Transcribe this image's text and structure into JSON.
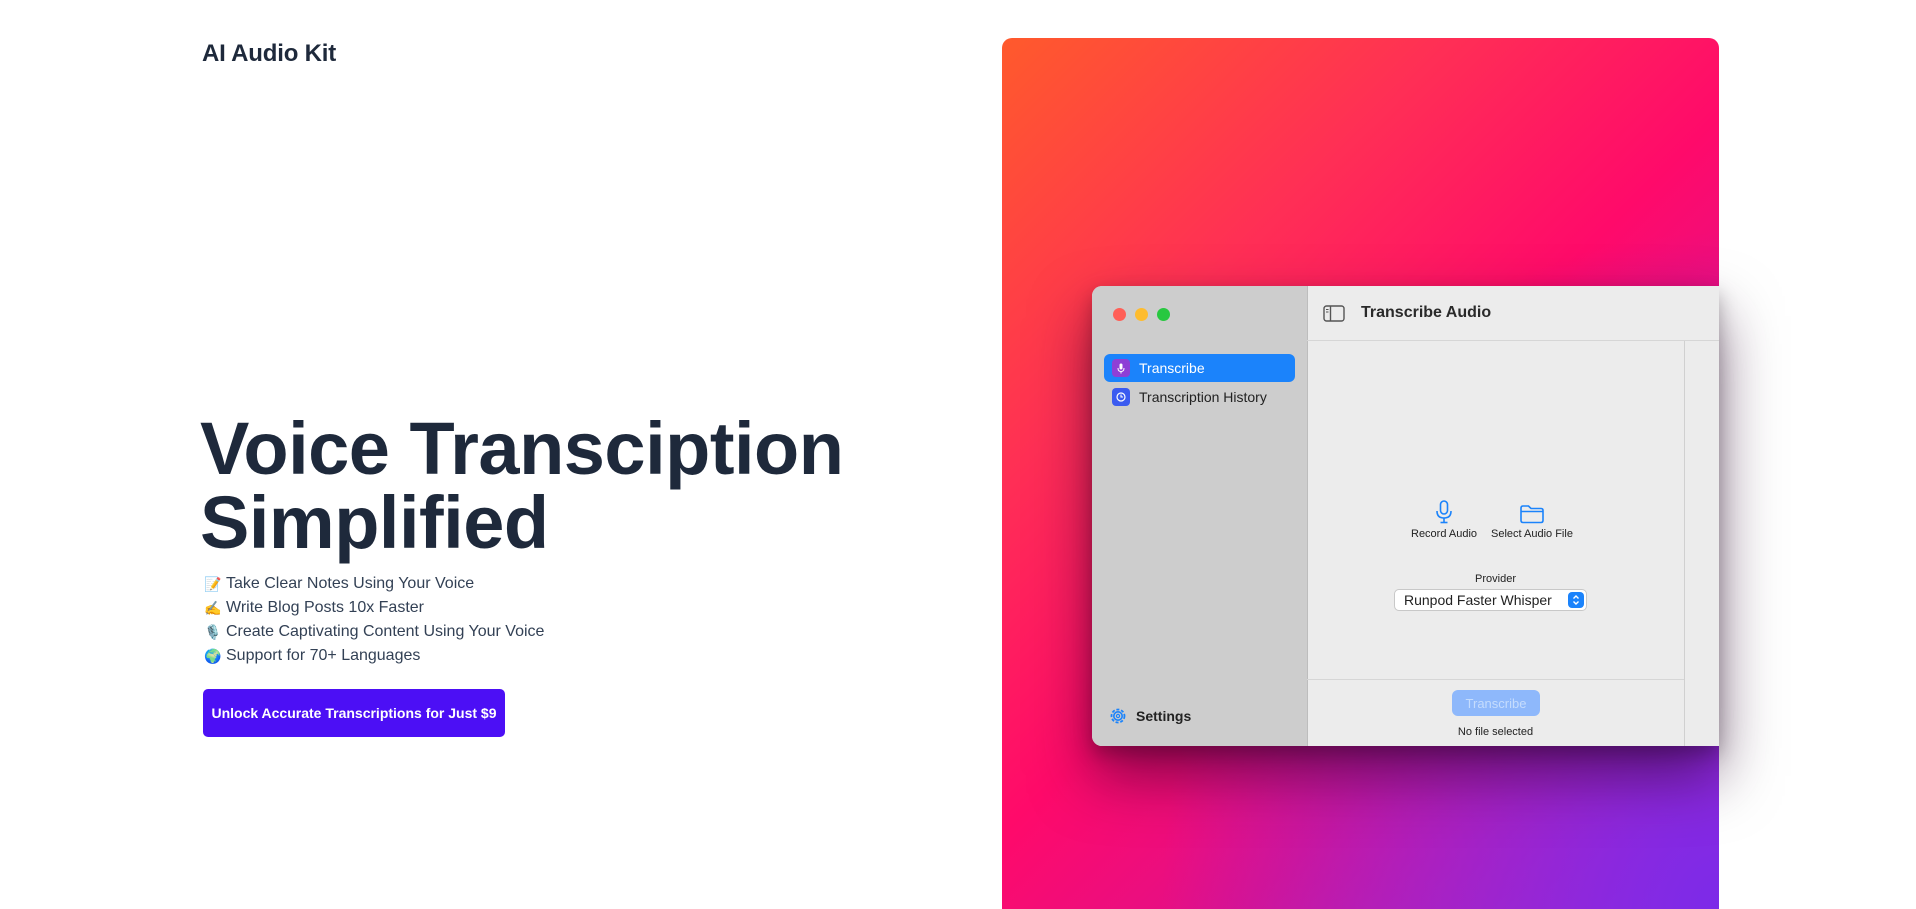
{
  "brand": {
    "name": "AI Audio Kit"
  },
  "hero": {
    "title_line1": "Voice Transciption",
    "title_line2": "Simplified"
  },
  "features": [
    {
      "emoji": "📝",
      "text": "Take Clear Notes Using Your Voice"
    },
    {
      "emoji": "✍️",
      "text": "Write Blog Posts 10x Faster"
    },
    {
      "emoji": "🎙️",
      "text": "Create Captivating Content Using Your Voice"
    },
    {
      "emoji": "🌍",
      "text": "Support for 70+ Languages"
    }
  ],
  "cta": {
    "label": "Unlock Accurate Transcriptions for Just $9"
  },
  "app": {
    "window_title": "Transcribe Audio",
    "sidebar": {
      "items": [
        {
          "label": "Transcribe",
          "icon": "mic-icon",
          "active": true
        },
        {
          "label": "Transcription History",
          "icon": "clock-icon",
          "active": false
        }
      ],
      "settings_label": "Settings"
    },
    "actions": {
      "record_label": "Record Audio",
      "select_label": "Select Audio File"
    },
    "provider": {
      "label": "Provider",
      "selected": "Runpod Faster Whisper"
    },
    "transcribe_label": "Transcribe",
    "status": "No file selected"
  },
  "colors": {
    "cta": "#4c0ff5",
    "accent_blue": "#1b83fb",
    "text_dark": "#1e293b",
    "gradient_start": "#ff5a2c",
    "gradient_mid": "#ff0a6a",
    "gradient_end": "#7c2ae8"
  }
}
